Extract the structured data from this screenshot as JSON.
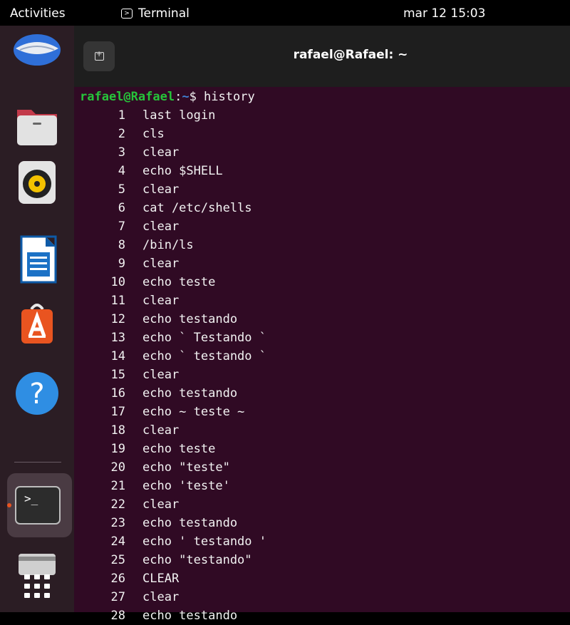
{
  "topbar": {
    "activities": "Activities",
    "app_name": "Terminal",
    "clock": "mar 12  15:03"
  },
  "dock": {
    "items": [
      "thunderbird-icon",
      "files-icon",
      "rhythmbox-icon",
      "writer-icon",
      "software-icon",
      "help-icon",
      "terminal-icon",
      "drive-icon",
      "app-grid-icon"
    ],
    "active_indicator_color": "#e95420"
  },
  "window": {
    "title": "rafael@Rafael: ~",
    "background": "#300a24"
  },
  "prompt": {
    "user_host": "rafael@Rafael",
    "colon": ":",
    "path": "~",
    "dollar": "$",
    "command": " history"
  },
  "history": [
    {
      "n": "1",
      "cmd": "last login"
    },
    {
      "n": "2",
      "cmd": "cls"
    },
    {
      "n": "3",
      "cmd": "clear"
    },
    {
      "n": "4",
      "cmd": "echo $SHELL"
    },
    {
      "n": "5",
      "cmd": "clear"
    },
    {
      "n": "6",
      "cmd": "cat /etc/shells"
    },
    {
      "n": "7",
      "cmd": "clear"
    },
    {
      "n": "8",
      "cmd": "/bin/ls"
    },
    {
      "n": "9",
      "cmd": "clear"
    },
    {
      "n": "10",
      "cmd": "echo teste"
    },
    {
      "n": "11",
      "cmd": "clear"
    },
    {
      "n": "12",
      "cmd": "echo testando"
    },
    {
      "n": "13",
      "cmd": "echo ` Testando `"
    },
    {
      "n": "14",
      "cmd": "echo ` testando `"
    },
    {
      "n": "15",
      "cmd": "clear"
    },
    {
      "n": "16",
      "cmd": "echo testando"
    },
    {
      "n": "17",
      "cmd": "echo ~ teste ~"
    },
    {
      "n": "18",
      "cmd": "clear"
    },
    {
      "n": "19",
      "cmd": "echo teste"
    },
    {
      "n": "20",
      "cmd": "echo \"teste\""
    },
    {
      "n": "21",
      "cmd": "echo 'teste'"
    },
    {
      "n": "22",
      "cmd": "clear"
    },
    {
      "n": "23",
      "cmd": "echo testando"
    },
    {
      "n": "24",
      "cmd": "echo ' testando '"
    },
    {
      "n": "25",
      "cmd": "echo \"testando\""
    },
    {
      "n": "26",
      "cmd": "CLEAR"
    },
    {
      "n": "27",
      "cmd": "clear"
    },
    {
      "n": "28",
      "cmd": "echo testando"
    }
  ]
}
